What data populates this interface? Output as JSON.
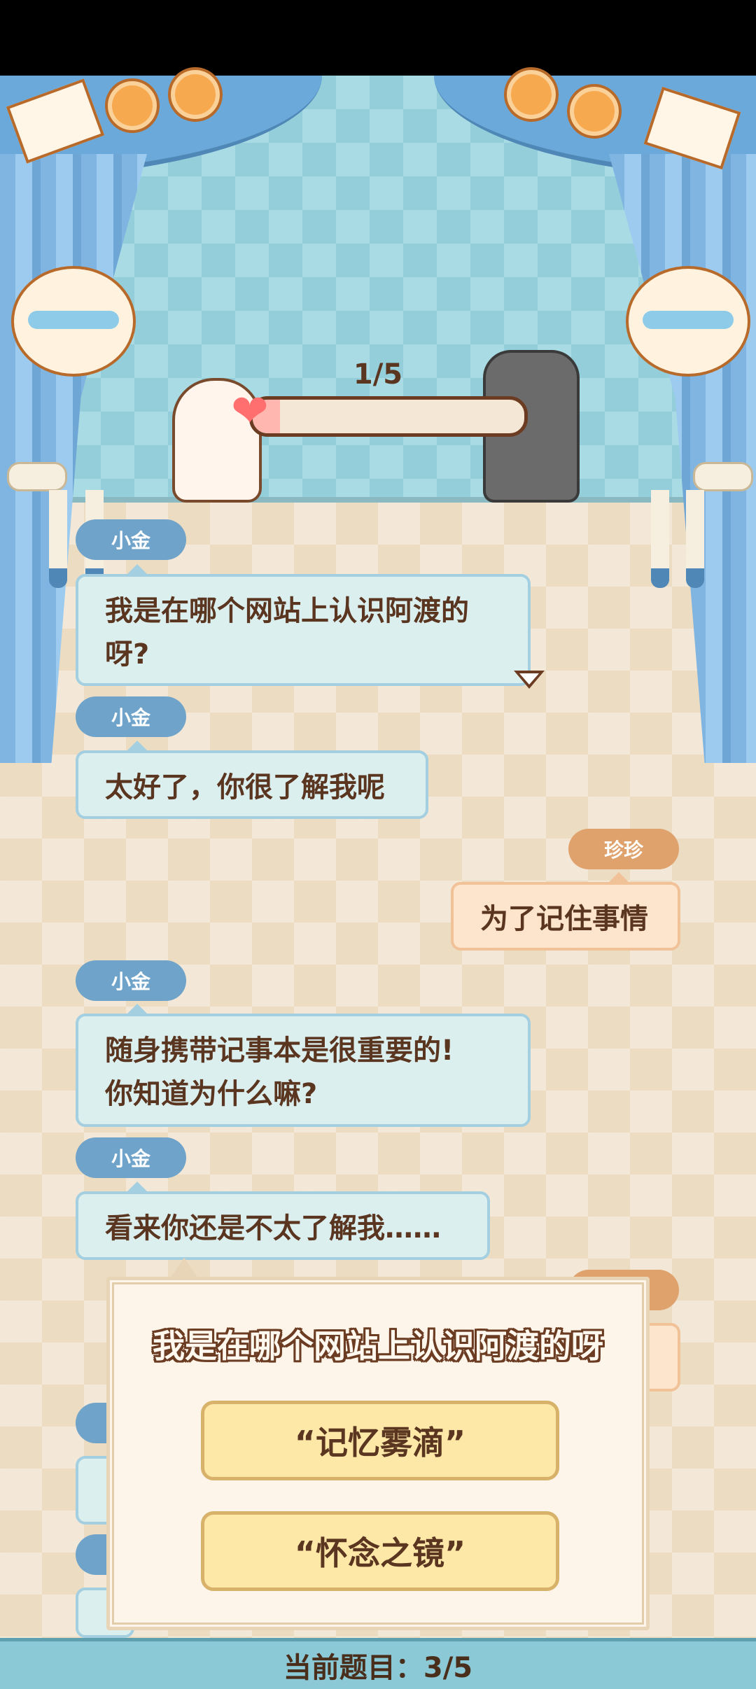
{
  "progress": {
    "label": "1/5",
    "fill": 0.1
  },
  "messages": [
    {
      "speaker": "小金",
      "side": "left",
      "text": "我是在哪个网站上认识阿渡的\n呀?"
    },
    {
      "speaker": "小金",
      "side": "left",
      "text": "太好了，你很了解我呢"
    },
    {
      "speaker": "珍珍",
      "side": "right",
      "text": "为了记住事情"
    },
    {
      "speaker": "小金",
      "side": "left",
      "text": "随身携带记事本是很重要的!\n你知道为什么嘛?"
    },
    {
      "speaker": "小金",
      "side": "left",
      "text": "看来你还是不太了解我……"
    }
  ],
  "quiz": {
    "question": "我是在哪个网站上认识阿渡的呀",
    "options": [
      "“记忆雾滴”",
      "“怀念之镜”"
    ]
  },
  "footer": {
    "text": "当前题目：3/5"
  },
  "colors": {
    "blue_tag": "#6fa3c9",
    "orange_tag": "#e0a26c",
    "brown_text": "#5a3520"
  }
}
